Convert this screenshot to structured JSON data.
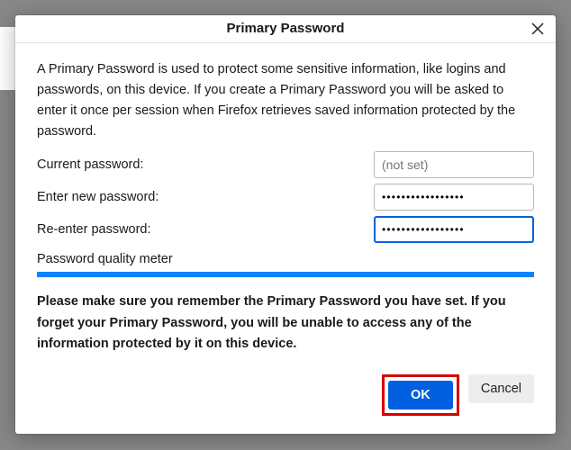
{
  "dialog": {
    "title": "Primary Password",
    "description": "A Primary Password is used to protect some sensitive information, like logins and passwords, on this device. If you create a Primary Password you will be asked to enter it once per session when Firefox retrieves saved information protected by the password.",
    "current_label": "Current password:",
    "current_placeholder": "(not set)",
    "enter_label": "Enter new password:",
    "enter_value": "•••••••••••••••••",
    "reenter_label": "Re-enter password:",
    "reenter_value": "•••••••••••••••••",
    "meter_label": "Password quality meter",
    "meter_value_percent": 100,
    "warning": "Please make sure you remember the Primary Password you have set. If you forget your Primary Password, you will be unable to access any of the information protected by it on this device.",
    "ok_label": "OK",
    "cancel_label": "Cancel"
  }
}
